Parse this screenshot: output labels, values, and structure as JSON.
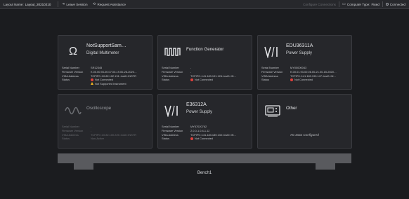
{
  "topbar": {
    "layout_label": "Layout Name:",
    "layout_value": "Layout_20210210",
    "leave_session": "Leave Session",
    "request_assistance": "Request Assistance",
    "configure_connections": "Configure Connections",
    "computer_type_label": "Computer Type:",
    "computer_type_value": "Fixed",
    "connection_status": "Connected"
  },
  "cards": [
    {
      "name": "NotSupportSam…",
      "subtitle": "Digital Multimeter",
      "icon": "omega-icon",
      "props": [
        {
          "label": "Serial Number",
          "value": "SR12345"
        },
        {
          "label": "Firmware Version",
          "value": "K.00.00.93-00.07.00-19.00-26-2020…"
        },
        {
          "label": "VISA Address",
          "value": "TCPIP0::10.82.102.131::inst0::INSTR"
        },
        {
          "label": "Status",
          "value": "Not Connected",
          "status": "red"
        },
        {
          "label": "",
          "value": "Not Supported Instrument",
          "status": "warn"
        }
      ]
    },
    {
      "name": "Function Generator",
      "subtitle": "",
      "icon": "square-wave-icon",
      "props": [
        {
          "label": "Serial Number",
          "value": "-"
        },
        {
          "label": "Firmware Version",
          "value": "-"
        },
        {
          "label": "VISA Address",
          "value": "TCPIP0::141.183.191.126::inst0::IN…"
        },
        {
          "label": "Status",
          "value": "Not Connected",
          "status": "red"
        }
      ]
    },
    {
      "name": "EDU36311A",
      "subtitle": "Power Supply",
      "icon": "vi-icon",
      "props": [
        {
          "label": "Serial Number",
          "value": "MY00000043"
        },
        {
          "label": "Firmware Version",
          "value": "K.00.01.93-00.06.00-21.00-15-2020…"
        },
        {
          "label": "VISA Address",
          "value": "TCPIP0::141.183.190.147::inst0::IN…"
        },
        {
          "label": "Status",
          "value": "Not Connected",
          "status": "red"
        }
      ]
    },
    {
      "name": "Oscilloscope",
      "subtitle": "",
      "icon": "sine-wave-icon",
      "props": [
        {
          "label": "Serial Number",
          "value": "-"
        },
        {
          "label": "Firmware Version",
          "value": "-"
        },
        {
          "label": "VISA Address",
          "value": "TCPIP0::10.82.100.225::inst0::INSTR"
        },
        {
          "label": "Status",
          "value": "Non-Active"
        }
      ]
    },
    {
      "name": "E36312A",
      "subtitle": "Power Supply",
      "icon": "vi-icon",
      "props": [
        {
          "label": "Serial Number",
          "value": "MY57020762"
        },
        {
          "label": "Firmware Version",
          "value": "2.0.0-1.0.4-1.12"
        },
        {
          "label": "VISA Address",
          "value": "TCPIP0::141.183.189.130::inst0::IN…"
        },
        {
          "label": "Status",
          "value": "Not Connected",
          "status": "red"
        }
      ]
    },
    {
      "name": "Other",
      "subtitle": "",
      "icon": "device-icon",
      "no_data": "No Data Configured"
    }
  ],
  "bench": {
    "label": "Bench1"
  }
}
